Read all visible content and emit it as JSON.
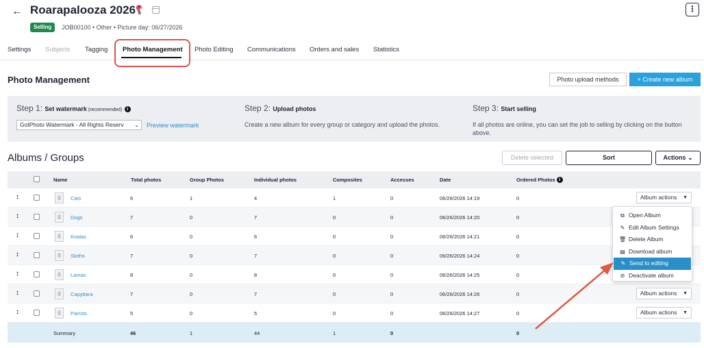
{
  "header": {
    "title": "Roarapalooza 2026",
    "status_badge": "Selling",
    "meta": "JOB00100  •  Other  •  Picture day: 06/27/2026",
    "more_icon": "kebab-icon"
  },
  "tabs": [
    {
      "label": "Settings"
    },
    {
      "label": "Subjects"
    },
    {
      "label": "Tagging"
    },
    {
      "label": "Photo Management"
    },
    {
      "label": "Photo Editing"
    },
    {
      "label": "Communications"
    },
    {
      "label": "Orders and sales"
    },
    {
      "label": "Statistics"
    }
  ],
  "active_tab": "Photo Management",
  "section": {
    "title": "Photo Management",
    "upload_methods_label": "Photo upload methods",
    "create_album_label": "+  Create new album"
  },
  "steps": {
    "step1": {
      "prefix": "Step 1: ",
      "title": "Set watermark",
      "note": " (recommended)",
      "watermark_value": "GotPhoto Watermark - All Rights Reserv",
      "preview_label": "Preview watermark"
    },
    "step2": {
      "prefix": "Step 2: ",
      "title": "Upload photos",
      "desc": "Create a new album for every group or category and upload the photos."
    },
    "step3": {
      "prefix": "Step 3: ",
      "title": "Start selling",
      "desc": "If all photos are online, you can set the job to selling by clicking on the button above."
    }
  },
  "albums": {
    "title": "Albums / Groups",
    "delete_label": "Delete selected",
    "sort_label": "Sort",
    "actions_label": "Actions",
    "columns": [
      "Name",
      "Total photos",
      "Group Photos",
      "Individual photos",
      "Composites",
      "Accesses",
      "Date",
      "Ordered Photos"
    ],
    "rows": [
      {
        "name": "Cats",
        "total": "6",
        "group": "1",
        "individual": "4",
        "composites": "1",
        "accesses": "0",
        "date": "06/26/2026 14:19",
        "ordered": "0",
        "action": "Album actions"
      },
      {
        "name": "Dogs",
        "total": "7",
        "group": "0",
        "individual": "7",
        "composites": "0",
        "accesses": "0",
        "date": "06/26/2026 14:20",
        "ordered": "0",
        "action": ""
      },
      {
        "name": "Koalas",
        "total": "6",
        "group": "0",
        "individual": "6",
        "composites": "0",
        "accesses": "0",
        "date": "06/26/2026 14:21",
        "ordered": "0",
        "action": ""
      },
      {
        "name": "Sloths",
        "total": "7",
        "group": "0",
        "individual": "7",
        "composites": "0",
        "accesses": "0",
        "date": "06/26/2026 14:24",
        "ordered": "0",
        "action": ""
      },
      {
        "name": "Lamas",
        "total": "8",
        "group": "0",
        "individual": "8",
        "composites": "0",
        "accesses": "0",
        "date": "06/26/2026 14:25",
        "ordered": "0",
        "action": ""
      },
      {
        "name": "Capybara",
        "total": "7",
        "group": "0",
        "individual": "7",
        "composites": "0",
        "accesses": "0",
        "date": "06/26/2026 14:26",
        "ordered": "0",
        "action": "Album actions"
      },
      {
        "name": "Parrots",
        "total": "5",
        "group": "0",
        "individual": "5",
        "composites": "0",
        "accesses": "0",
        "date": "06/26/2026 14:27",
        "ordered": "0",
        "action": "Album actions"
      }
    ],
    "summary": {
      "label": "Summary",
      "total": "46",
      "group": "1",
      "individual": "44",
      "composites": "1",
      "accesses": "0",
      "ordered": "0"
    }
  },
  "album_menu": [
    {
      "label": "Open Album",
      "icon": "external-link-icon",
      "glyph": "⧉"
    },
    {
      "label": "Edit Album Settings",
      "icon": "pencil-icon",
      "glyph": "✎"
    },
    {
      "label": "Delete Album",
      "icon": "trash-icon",
      "glyph": "🗑"
    },
    {
      "label": "Download album",
      "icon": "file-icon",
      "glyph": "▤"
    },
    {
      "label": "Send to editing",
      "icon": "edit-icon",
      "glyph": "✎"
    },
    {
      "label": "Deactivate album",
      "icon": "ban-icon",
      "glyph": "⊘"
    }
  ],
  "colors": {
    "accent": "#2aa0dd",
    "badge": "#1e8a4c",
    "annotation": "#d9534f",
    "summary_bg": "#dcedf5"
  }
}
